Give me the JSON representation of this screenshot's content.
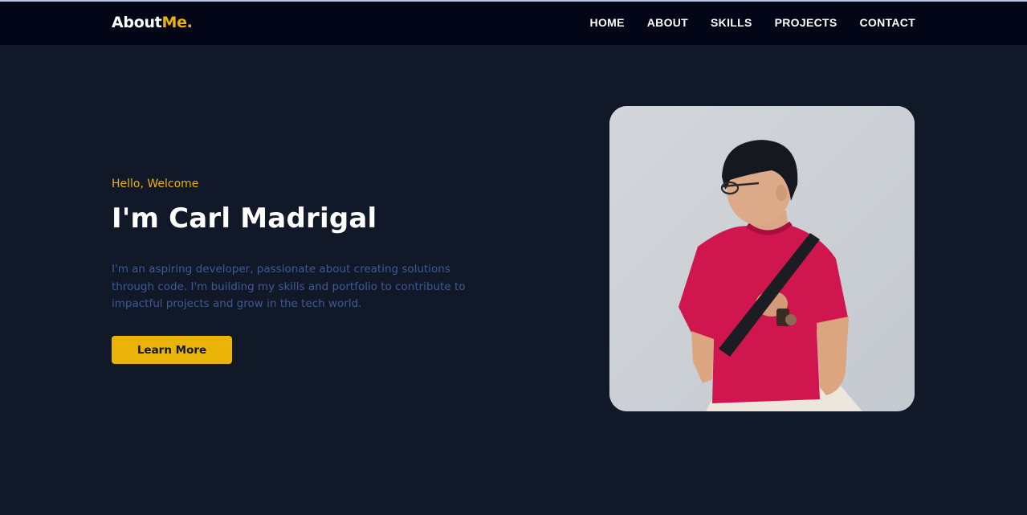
{
  "brand": {
    "name_main": "About",
    "name_accent": "Me."
  },
  "nav": {
    "items": [
      {
        "label": "HOME"
      },
      {
        "label": "ABOUT"
      },
      {
        "label": "SKILLS"
      },
      {
        "label": "PROJECTS"
      },
      {
        "label": "CONTACT"
      }
    ]
  },
  "hero": {
    "greeting": "Hello, Welcome",
    "title": "I'm Carl Madrigal",
    "description": "I'm an aspiring developer, passionate about creating solutions through code. I'm building my skills and portfolio to contribute to impactful projects and grow in the tech world.",
    "cta_label": "Learn More"
  },
  "colors": {
    "background": "#111827",
    "navbar": "#020617",
    "accent": "#eab308",
    "description_text": "#3e5a96"
  }
}
